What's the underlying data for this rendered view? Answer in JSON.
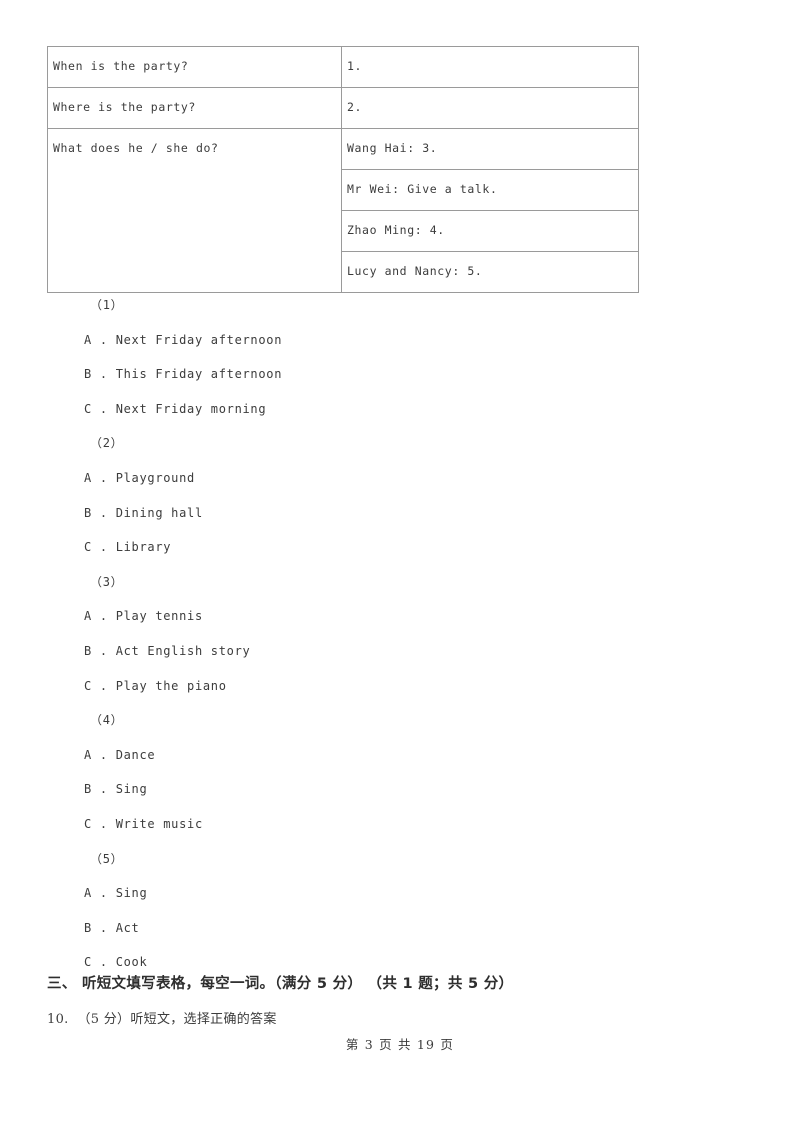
{
  "document": {
    "table": {
      "rows": [
        {
          "question": "When is the party?",
          "answer": "1."
        },
        {
          "question": "Where is the party?",
          "answer": "2."
        },
        {
          "question": "What does he / she do?",
          "answer": "Wang Hai: 3."
        },
        {
          "question": "",
          "answer": "Mr Wei: Give a talk."
        },
        {
          "question": "",
          "answer": "Zhao Ming: 4."
        },
        {
          "question": "",
          "answer": "Lucy and Nancy: 5."
        }
      ]
    },
    "questions": [
      {
        "marker": "（1）",
        "options": [
          "A . Next Friday afternoon",
          "B . This Friday afternoon",
          "C . Next Friday morning"
        ]
      },
      {
        "marker": "（2）",
        "options": [
          "A . Playground",
          "B . Dining hall",
          "C . Library"
        ]
      },
      {
        "marker": "（3）",
        "options": [
          "A . Play tennis",
          "B . Act English story",
          "C . Play the piano"
        ]
      },
      {
        "marker": "（4）",
        "options": [
          "A . Dance",
          "B . Sing",
          "C . Write music"
        ]
      },
      {
        "marker": "（5）",
        "options": [
          "A . Sing",
          "B . Act",
          "C . Cook"
        ]
      }
    ],
    "section_heading": "三、 听短文填写表格，每空一词。（满分 5 分） （共 1 题；共 5 分）",
    "question_stem": "10.  （5 分）听短文，选择正确的答案",
    "footer": "第 3 页 共 19 页"
  }
}
